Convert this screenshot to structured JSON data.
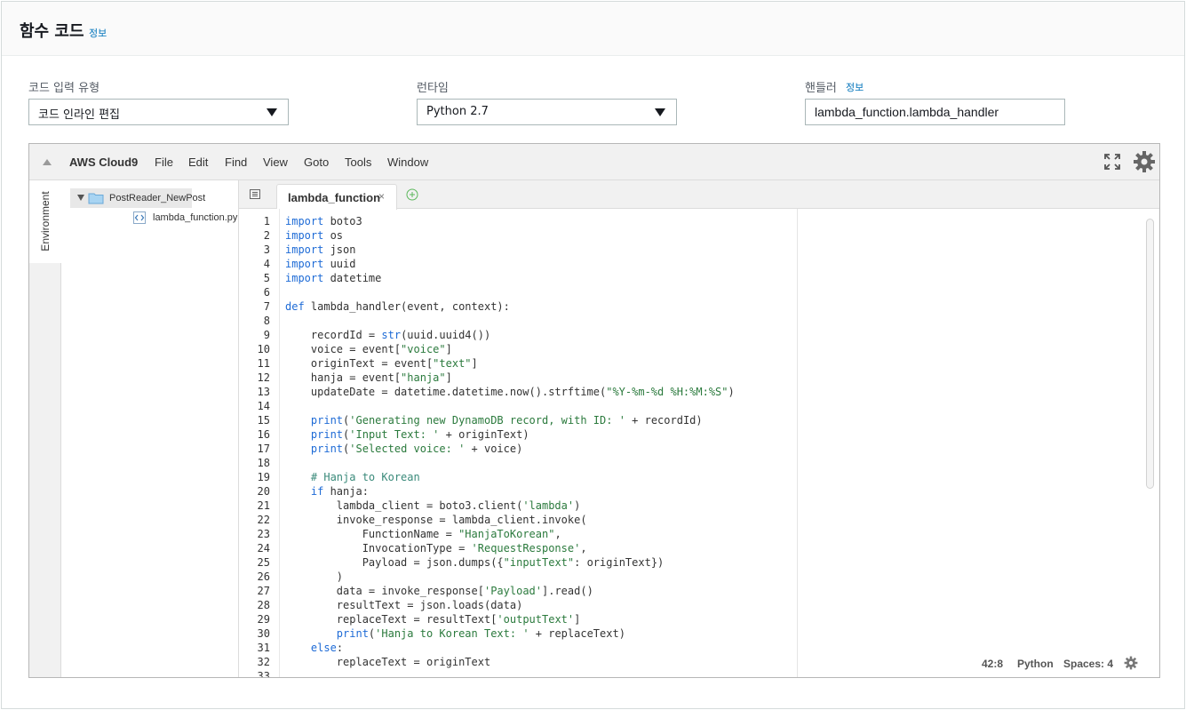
{
  "header": {
    "title": "함수 코드",
    "info_link": "정보"
  },
  "fields": {
    "code_entry_type": {
      "label": "코드 입력 유형",
      "value": "코드 인라인 편집"
    },
    "runtime": {
      "label": "런타임",
      "value": "Python 2.7"
    },
    "handler": {
      "label": "핸들러",
      "info_link": "정보",
      "value": "lambda_function.lambda_handler"
    }
  },
  "ide": {
    "brand": "AWS Cloud9",
    "menu": [
      "File",
      "Edit",
      "Find",
      "View",
      "Goto",
      "Tools",
      "Window"
    ],
    "environment_tab": "Environment",
    "tree": {
      "root": "PostReader_NewPost",
      "file": "lambda_function.py"
    },
    "tab": {
      "label": "lambda_function",
      "close": "×"
    },
    "status": {
      "cursor": "42:8",
      "language": "Python",
      "spaces": "Spaces: 4"
    },
    "code_lines": [
      "import boto3",
      "import os",
      "import json",
      "import uuid",
      "import datetime",
      "",
      "def lambda_handler(event, context):",
      "",
      "    recordId = str(uuid.uuid4())",
      "    voice = event[\"voice\"]",
      "    originText = event[\"text\"]",
      "    hanja = event[\"hanja\"]",
      "    updateDate = datetime.datetime.now().strftime(\"%Y-%m-%d %H:%M:%S\")",
      "",
      "    print('Generating new DynamoDB record, with ID: ' + recordId)",
      "    print('Input Text: ' + originText)",
      "    print('Selected voice: ' + voice)",
      "",
      "    # Hanja to Korean",
      "    if hanja:",
      "        lambda_client = boto3.client('lambda')",
      "        invoke_response = lambda_client.invoke(",
      "            FunctionName = \"HanjaToKorean\",",
      "            InvocationType = 'RequestResponse',",
      "            Payload = json.dumps({\"inputText\": originText})",
      "        )",
      "        data = invoke_response['Payload'].read()",
      "        resultText = json.loads(data)",
      "        replaceText = resultText['outputText']",
      "        print('Hanja to Korean Text: ' + replaceText)",
      "    else:",
      "        replaceText = originText",
      ""
    ]
  }
}
